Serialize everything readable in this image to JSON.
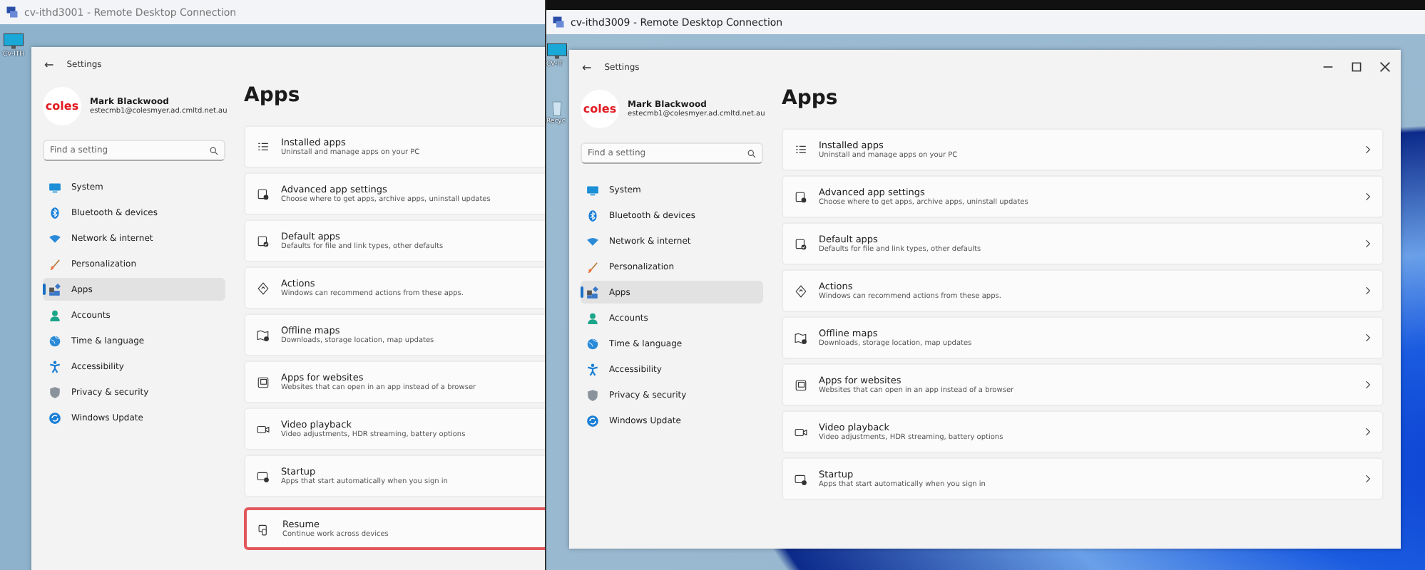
{
  "rdp_windows": [
    {
      "title": "cv-ithd3001 - Remote Desktop Connection",
      "desktop_icons": [
        {
          "label": "CV-ITH",
          "kind": "monitor"
        }
      ],
      "window_controls": false,
      "chevrons": false,
      "settings": {
        "back": "←",
        "title": "Settings",
        "user": {
          "avatar": "coles",
          "name": "Mark Blackwood",
          "email": "estecmb1@colesmyer.ad.cmltd.net.au"
        },
        "search": {
          "placeholder": "Find a setting"
        },
        "nav": [
          {
            "label": "System",
            "selected": false
          },
          {
            "label": "Bluetooth & devices",
            "selected": false
          },
          {
            "label": "Network & internet",
            "selected": false
          },
          {
            "label": "Personalization",
            "selected": false
          },
          {
            "label": "Apps",
            "selected": true
          },
          {
            "label": "Accounts",
            "selected": false
          },
          {
            "label": "Time & language",
            "selected": false
          },
          {
            "label": "Accessibility",
            "selected": false
          },
          {
            "label": "Privacy & security",
            "selected": false
          },
          {
            "label": "Windows Update",
            "selected": false
          }
        ],
        "heading": "Apps",
        "cards": [
          {
            "title": "Installed apps",
            "subtitle": "Uninstall and manage apps on your PC",
            "highlighted": false
          },
          {
            "title": "Advanced app settings",
            "subtitle": "Choose where to get apps, archive apps, uninstall updates",
            "highlighted": false
          },
          {
            "title": "Default apps",
            "subtitle": "Defaults for file and link types, other defaults",
            "highlighted": false
          },
          {
            "title": "Actions",
            "subtitle": "Windows can recommend actions from these apps.",
            "highlighted": false
          },
          {
            "title": "Offline maps",
            "subtitle": "Downloads, storage location, map updates",
            "highlighted": false
          },
          {
            "title": "Apps for websites",
            "subtitle": "Websites that can open in an app instead of a browser",
            "highlighted": false
          },
          {
            "title": "Video playback",
            "subtitle": "Video adjustments, HDR streaming, battery options",
            "highlighted": false
          },
          {
            "title": "Startup",
            "subtitle": "Apps that start automatically when you sign in",
            "highlighted": false
          },
          {
            "title": "Resume",
            "subtitle": "Continue work across devices",
            "highlighted": true
          }
        ]
      }
    },
    {
      "title": "cv-ithd3009 - Remote Desktop Connection",
      "desktop_icons": [
        {
          "label": "CV-IT",
          "kind": "monitor"
        },
        {
          "label": "Recyc",
          "kind": "bin"
        }
      ],
      "window_controls": true,
      "chevrons": true,
      "settings": {
        "back": "←",
        "title": "Settings",
        "user": {
          "avatar": "coles",
          "name": "Mark Blackwood",
          "email": "estecmb1@colesmyer.ad.cmltd.net.au"
        },
        "search": {
          "placeholder": "Find a setting"
        },
        "nav": [
          {
            "label": "System",
            "selected": false
          },
          {
            "label": "Bluetooth & devices",
            "selected": false
          },
          {
            "label": "Network & internet",
            "selected": false
          },
          {
            "label": "Personalization",
            "selected": false
          },
          {
            "label": "Apps",
            "selected": true
          },
          {
            "label": "Accounts",
            "selected": false
          },
          {
            "label": "Time & language",
            "selected": false
          },
          {
            "label": "Accessibility",
            "selected": false
          },
          {
            "label": "Privacy & security",
            "selected": false
          },
          {
            "label": "Windows Update",
            "selected": false
          }
        ],
        "heading": "Apps",
        "cards": [
          {
            "title": "Installed apps",
            "subtitle": "Uninstall and manage apps on your PC",
            "highlighted": false
          },
          {
            "title": "Advanced app settings",
            "subtitle": "Choose where to get apps, archive apps, uninstall updates",
            "highlighted": false
          },
          {
            "title": "Default apps",
            "subtitle": "Defaults for file and link types, other defaults",
            "highlighted": false
          },
          {
            "title": "Actions",
            "subtitle": "Windows can recommend actions from these apps.",
            "highlighted": false
          },
          {
            "title": "Offline maps",
            "subtitle": "Downloads, storage location, map updates",
            "highlighted": false
          },
          {
            "title": "Apps for websites",
            "subtitle": "Websites that can open in an app instead of a browser",
            "highlighted": false
          },
          {
            "title": "Video playback",
            "subtitle": "Video adjustments, HDR streaming, battery options",
            "highlighted": false
          },
          {
            "title": "Startup",
            "subtitle": "Apps that start automatically when you sign in",
            "highlighted": false
          }
        ]
      }
    }
  ]
}
